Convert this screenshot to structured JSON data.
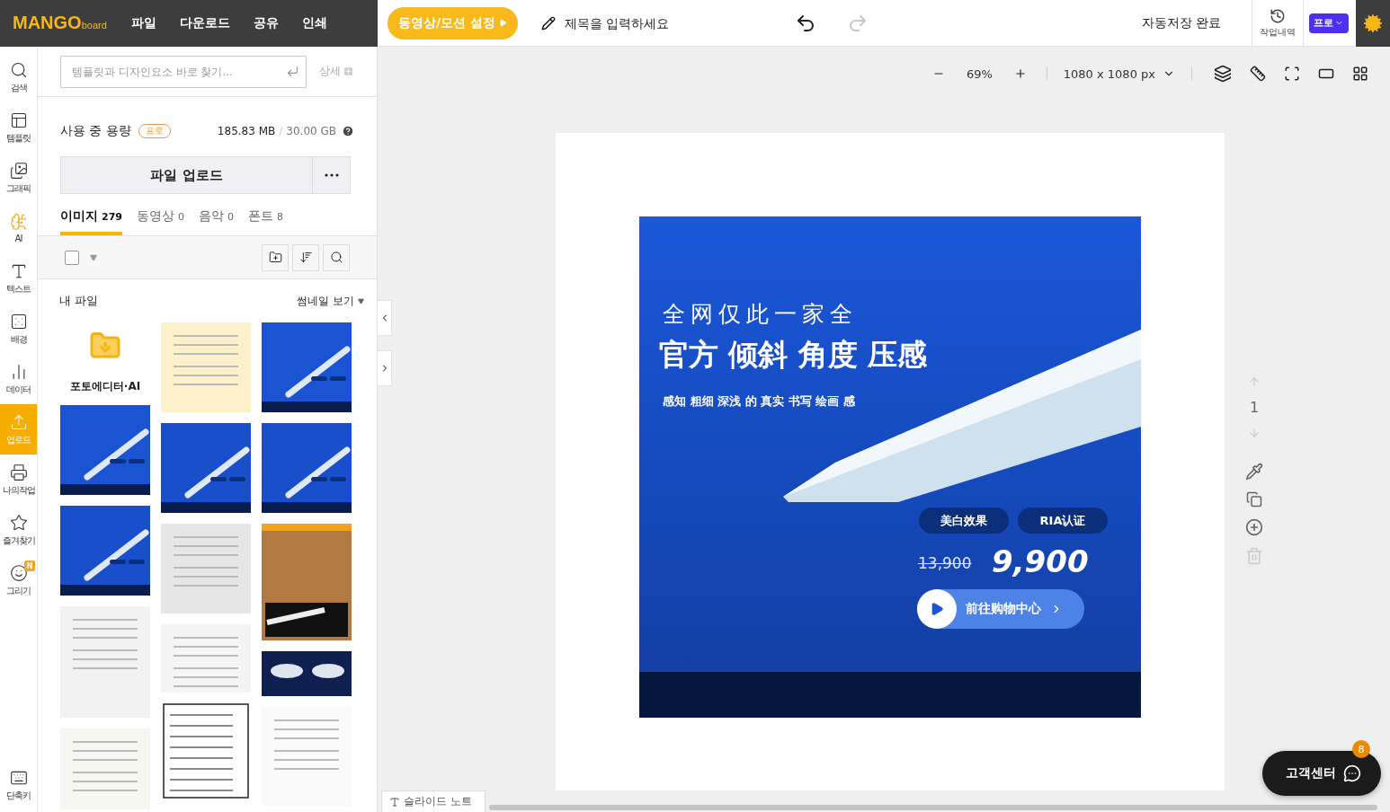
{
  "top_bar": {
    "logo": {
      "main": "MANGO",
      "sub": "board"
    },
    "menu": [
      "파일",
      "다운로드",
      "공유",
      "인쇄"
    ],
    "motion_button": "동영상/모션 설정",
    "title": {
      "placeholder": "제목을 입력하세요"
    },
    "history_nav": [
      {
        "kind": "undo",
        "disabled": false
      },
      {
        "kind": "redo",
        "disabled": true
      }
    ],
    "autosave": "자동저장 완료",
    "history": "작업내역",
    "plan_button": "프로"
  },
  "sidebar": {
    "items": [
      {
        "kind": "search",
        "label": "검색",
        "selected": false
      },
      {
        "kind": "template",
        "label": "템플릿",
        "selected": false
      },
      {
        "kind": "graphic",
        "label": "그래픽",
        "selected": false
      },
      {
        "kind": "ai",
        "label": "AI",
        "selected": false
      },
      {
        "kind": "text",
        "label": "텍스트",
        "selected": false
      },
      {
        "kind": "background",
        "label": "배경",
        "selected": false
      },
      {
        "kind": "data",
        "label": "데이터",
        "selected": false
      },
      {
        "kind": "upload",
        "label": "업로드",
        "selected": true
      },
      {
        "kind": "work",
        "label": "나의작업",
        "selected": false
      },
      {
        "kind": "favorite",
        "label": "즐겨찾기",
        "selected": false
      },
      {
        "kind": "draw",
        "label": "그리기",
        "selected": false,
        "badge": "N"
      }
    ],
    "bottom_item": {
      "label": "단축키"
    }
  },
  "panel": {
    "search": {
      "placeholder": "템플릿과 디자인요소 바로 찾기..."
    },
    "detail_link": "상세",
    "storage": {
      "label": "사용 중 용량",
      "badge": "프로",
      "used": "185.83 MB",
      "separator": "/",
      "total": "30.00 GB"
    },
    "upload_button": "파일 업로드",
    "tabs": [
      {
        "label": "이미지",
        "count": "279",
        "selected": true
      },
      {
        "label": "동영상",
        "count": "0",
        "selected": false
      },
      {
        "label": "음악",
        "count": "0",
        "selected": false
      },
      {
        "label": "폰트",
        "count": "8",
        "selected": false
      }
    ],
    "select_all": {
      "checked": false
    },
    "folder": "내 파일",
    "view_mode": "썸네일 보기",
    "file_columns": [
      {
        "items": [
          {
            "kind": "app",
            "label": "포토에디터·AI"
          },
          {
            "kind": "pen"
          },
          {
            "kind": "toothpaste"
          },
          {
            "kind": "pen-sheet"
          },
          {
            "kind": "note"
          }
        ]
      },
      {
        "items": [
          {
            "kind": "cream"
          },
          {
            "kind": "toothpaste"
          },
          {
            "kind": "letter"
          },
          {
            "kind": "laundry"
          },
          {
            "kind": "document"
          }
        ]
      },
      {
        "items": [
          {
            "kind": "pen"
          },
          {
            "kind": "toothpaste"
          },
          {
            "kind": "barbell"
          },
          {
            "kind": "mouse"
          },
          {
            "kind": "list"
          }
        ]
      }
    ]
  },
  "canvas": {
    "zoom": "69%",
    "size": "1080 x 1080 px",
    "page_number": "1",
    "page_tools": [
      {
        "kind": "up",
        "disabled": true
      },
      {
        "kind": "down",
        "disabled": true
      },
      {
        "kind": "color",
        "disabled": false
      },
      {
        "kind": "copy",
        "disabled": false
      },
      {
        "kind": "add",
        "disabled": false
      },
      {
        "kind": "delete",
        "disabled": true
      }
    ],
    "design": {
      "line1": "全网仅此一家全",
      "headline": "官方 倾斜 角度 压感",
      "subline": "感知 粗细 深浅 的 真实 书写 绘画 感",
      "tags": [
        "美白效果",
        "RIA认证"
      ],
      "old_price": "13,900",
      "price": "9,900",
      "cta": "前往购物中心"
    }
  },
  "slide_note": "슬라이드 노트",
  "help": {
    "label": "고객센터",
    "badge": "8"
  }
}
